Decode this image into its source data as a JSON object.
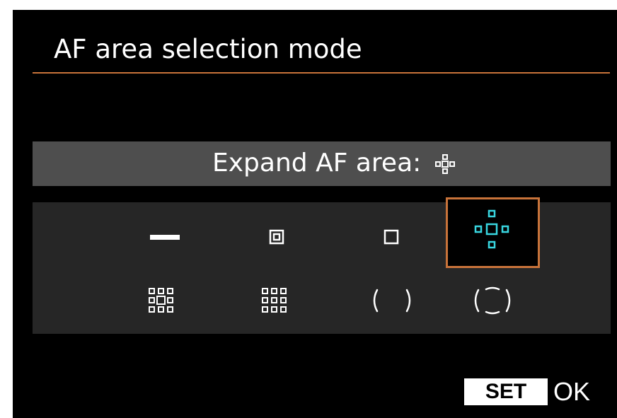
{
  "screen": {
    "title": "AF area selection mode",
    "current_mode_label": "Expand AF area:",
    "current_mode_icon": "expand-af-area-cross-icon"
  },
  "options": [
    {
      "name": "spot-af-single-point",
      "icon": "flat-bar-icon",
      "selected": false
    },
    {
      "name": "single-point-af-spot",
      "icon": "framed-point-icon",
      "selected": false
    },
    {
      "name": "single-point-af",
      "icon": "square-point-icon",
      "selected": false
    },
    {
      "name": "expand-af-area-cross",
      "icon": "cross-expand-icon",
      "selected": true
    },
    {
      "name": "expand-af-area-surround",
      "icon": "surround-expand-icon",
      "selected": false
    },
    {
      "name": "zone-af",
      "icon": "zone-grid-icon",
      "selected": false
    },
    {
      "name": "large-zone-af",
      "icon": "large-zone-brackets-icon",
      "selected": false
    },
    {
      "name": "auto-af-point-selection",
      "icon": "auto-selection-brackets-icon",
      "selected": false
    }
  ],
  "footer": {
    "set_label": "SET",
    "ok_label": "OK"
  },
  "colors": {
    "background": "#000000",
    "accent": "#c8733a",
    "selected_icon": "#38d6e0",
    "mode_bar": "#4e4e4e",
    "panel": "#262626"
  }
}
